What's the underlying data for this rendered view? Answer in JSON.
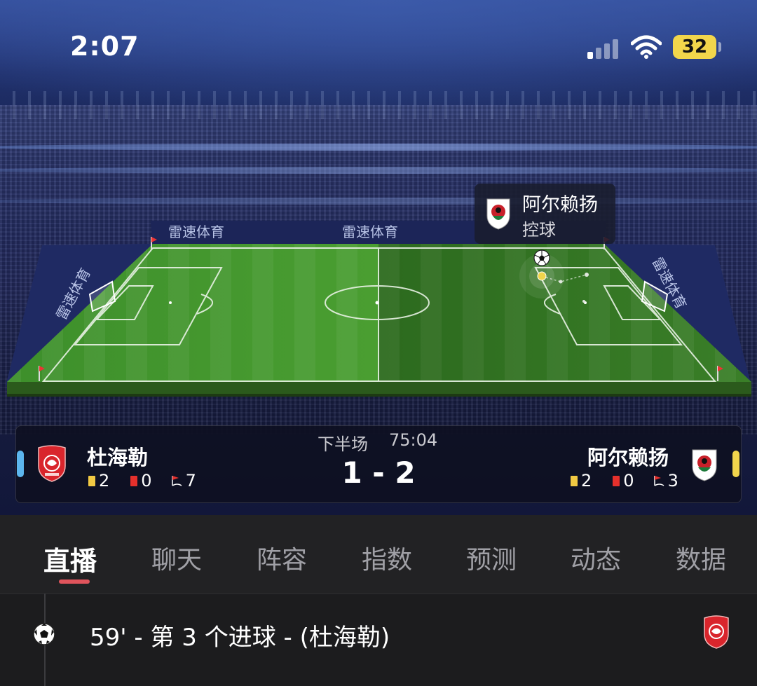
{
  "status_bar": {
    "time": "2:07",
    "battery": "32"
  },
  "stadium": {
    "board_text": [
      "雷速体育",
      "雷速体育",
      "雷速体育",
      "雷速体育"
    ]
  },
  "possession": {
    "team": "阿尔赖扬",
    "state": "控球"
  },
  "match": {
    "period": "下半场",
    "clock": "75:04",
    "score": "1 - 2",
    "home": {
      "name": "杜海勒",
      "yellow": "2",
      "red": "0",
      "corners": "7",
      "color": "#5cb6ee",
      "crest_color": "#d9252c"
    },
    "away": {
      "name": "阿尔赖扬",
      "yellow": "2",
      "red": "0",
      "corners": "3",
      "color": "#f1d54c",
      "crest_color": "#c8202a"
    }
  },
  "tabs": [
    {
      "label": "直播",
      "active": true
    },
    {
      "label": "聊天"
    },
    {
      "label": "阵容"
    },
    {
      "label": "指数"
    },
    {
      "label": "预测"
    },
    {
      "label": "动态"
    },
    {
      "label": "数据"
    }
  ],
  "timeline": [
    {
      "icon": "soccer-ball-icon",
      "text": "59' - 第 3 个进球 - (杜海勒)"
    }
  ]
}
